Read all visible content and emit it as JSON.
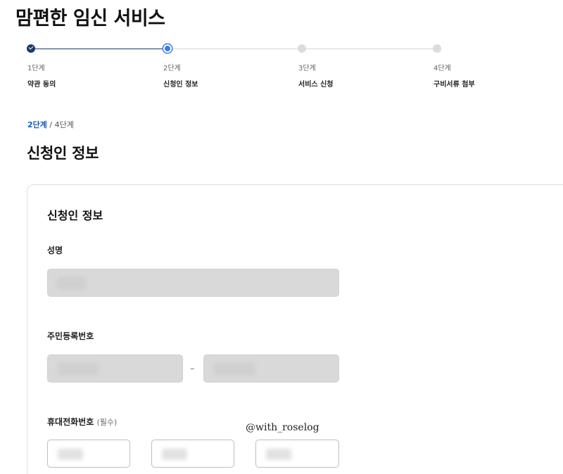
{
  "page": {
    "title": "맘편한 임신 서비스"
  },
  "stepper": {
    "steps": [
      {
        "number": "1단계",
        "name": "약관 동의",
        "state": "done"
      },
      {
        "number": "2단계",
        "name": "신청인 정보",
        "state": "current"
      },
      {
        "number": "3단계",
        "name": "서비스 신청",
        "state": "todo"
      },
      {
        "number": "4단계",
        "name": "구비서류 첨부",
        "state": "todo"
      }
    ],
    "colors": {
      "done": "#1a3a6e",
      "current": "#3a7de0",
      "todo": "#dcdcdc"
    }
  },
  "progress": {
    "current": "2단계",
    "separator": " / ",
    "total": "4단계"
  },
  "section": {
    "title": "신청인 정보"
  },
  "form": {
    "card_title": "신청인 정보",
    "name_label": "성명",
    "rrn_label": "주민등록번호",
    "rrn_separator": "–",
    "phone_label": "휴대전화번호",
    "phone_required": "(필수)"
  },
  "watermark": "@with_roselog",
  "icons": {
    "step_done": "check-icon"
  }
}
